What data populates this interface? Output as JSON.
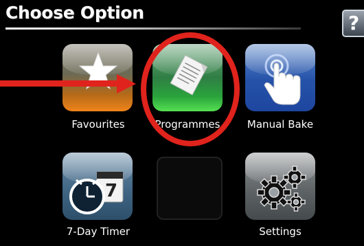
{
  "header": {
    "title": "Choose Option",
    "help_label": "?"
  },
  "tiles": {
    "favourites": {
      "label": "Favourites",
      "icon": "star-icon"
    },
    "programmes": {
      "label": "Programmes",
      "icon": "document-icon"
    },
    "manual_bake": {
      "label": "Manual Bake",
      "icon": "hand-touch-icon"
    },
    "seven_day_timer": {
      "label": "7-Day Timer",
      "icon": "clock-calendar-icon"
    },
    "settings": {
      "label": "Settings",
      "icon": "gears-icon"
    }
  },
  "annotation": {
    "color": "#e0231c"
  }
}
